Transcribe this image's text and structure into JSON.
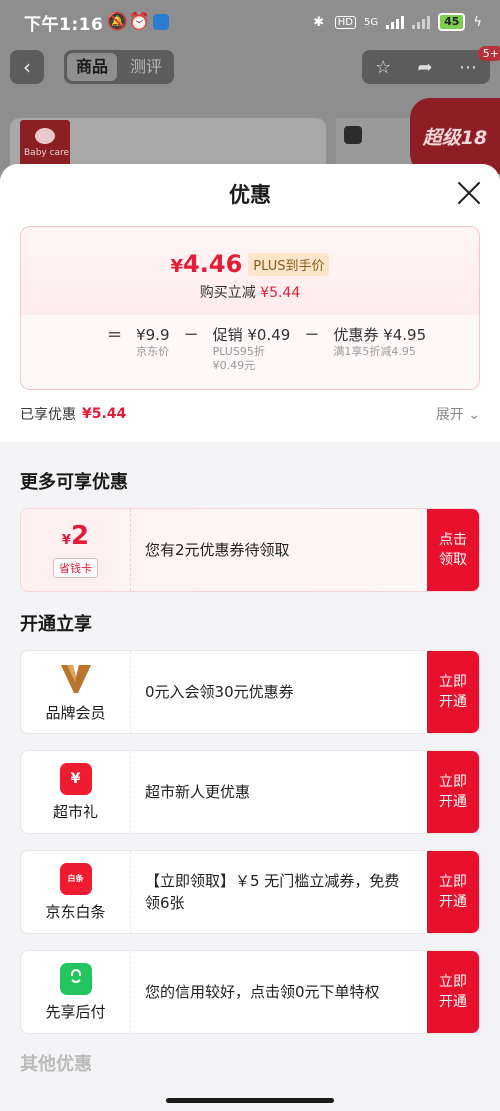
{
  "status_bar": {
    "time": "下午1:16",
    "signal_label": "5G",
    "battery": "45"
  },
  "top_nav": {
    "tabs": [
      "商品",
      "测评"
    ],
    "active_tab": "商品",
    "badge": "5+"
  },
  "background_banner": {
    "brand_logo_text": "Baby care",
    "promo_text": "超级18"
  },
  "sheet": {
    "title": "优惠",
    "summary": {
      "price_currency": "¥",
      "price_value": "4.46",
      "price_tag": "PLUS到手价",
      "buy_reduce_label": "购买立减",
      "buy_reduce_value": "¥5.44",
      "equals": "=",
      "minus": "−",
      "breakdown": [
        {
          "value": "¥9.9",
          "sub": "京东价",
          "sub2": ""
        },
        {
          "value": "促销 ¥0.49",
          "sub": "PLUS95折",
          "sub2": "¥0.49元"
        },
        {
          "value": "优惠券 ¥4.95",
          "sub": "满1享5折减4.95",
          "sub2": ""
        }
      ],
      "enjoyed_label": "已享优惠",
      "enjoyed_value": "¥5.44",
      "expand_label": "展开 ⌄"
    },
    "more_section": {
      "title": "更多可享优惠",
      "items": [
        {
          "amount_currency": "¥",
          "amount": "2",
          "tag": "省钱卡",
          "text": "您有2元优惠券待领取",
          "action_line1": "点击",
          "action_line2": "领取"
        }
      ]
    },
    "open_section": {
      "title": "开通立享",
      "items": [
        {
          "label": "品牌会员",
          "text": "0元入会领30元优惠券",
          "action_line1": "立即",
          "action_line2": "开通",
          "icon": "brand-v-icon"
        },
        {
          "label": "超市礼",
          "text": "超市新人更优惠",
          "action_line1": "立即",
          "action_line2": "开通",
          "icon": "ticket-yen-icon",
          "icon_glyph": "¥"
        },
        {
          "label": "京东白条",
          "text": "【立即领取】￥5 无门槛立减券，免费领6张",
          "action_line1": "立即",
          "action_line2": "开通",
          "icon": "baitiao-icon",
          "icon_glyph": "白条"
        },
        {
          "label": "先享后付",
          "text": "您的信用较好，点击领0元下单特权",
          "action_line1": "立即",
          "action_line2": "开通",
          "icon": "shopping-bag-icon"
        }
      ]
    },
    "other_section_title": "其他优惠"
  },
  "colors": {
    "accent_red": "#e31d37",
    "action_red": "#e8102d",
    "plus_tag_bg": "#fbe6c9"
  }
}
